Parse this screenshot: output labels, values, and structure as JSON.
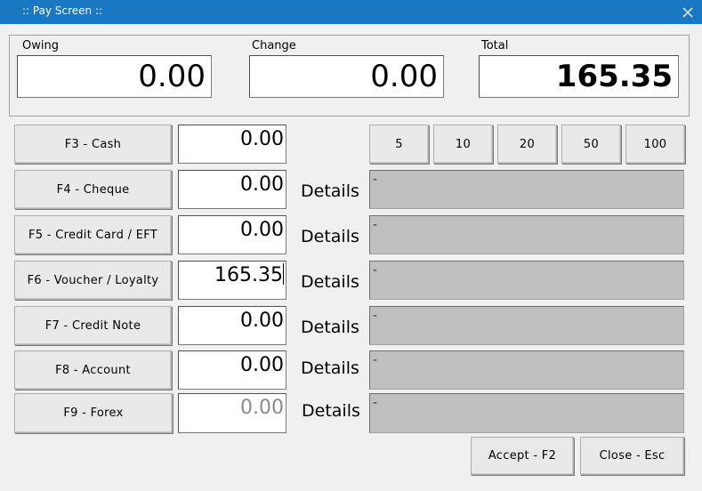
{
  "window": {
    "title": ":: Pay Screen ::"
  },
  "totals": {
    "owing_label": "Owing",
    "owing_value": "0.00",
    "change_label": "Change",
    "change_value": "0.00",
    "total_label": "Total",
    "total_value": "165.35"
  },
  "payments": [
    {
      "label": "F3 - Cash",
      "amount": "0.00"
    },
    {
      "label": "F4 - Cheque",
      "amount": "0.00",
      "details_label": "Details",
      "details_value": "-"
    },
    {
      "label": "F5 - Credit Card / EFT",
      "amount": "0.00",
      "details_label": "Details",
      "details_value": "-"
    },
    {
      "label": "F6 - Voucher / Loyalty",
      "amount": "165.35",
      "details_label": "Details",
      "details_value": "-"
    },
    {
      "label": "F7 - Credit Note",
      "amount": "0.00",
      "details_label": "Details",
      "details_value": "-"
    },
    {
      "label": "F8 - Account",
      "amount": "0.00",
      "details_label": "Details",
      "details_value": "-"
    },
    {
      "label": "F9 - Forex",
      "amount": "0.00",
      "details_label": "Details",
      "details_value": "-"
    }
  ],
  "quick_cash": [
    "5",
    "10",
    "20",
    "50",
    "100"
  ],
  "actions": {
    "accept": "Accept - F2",
    "close": "Close - Esc"
  }
}
